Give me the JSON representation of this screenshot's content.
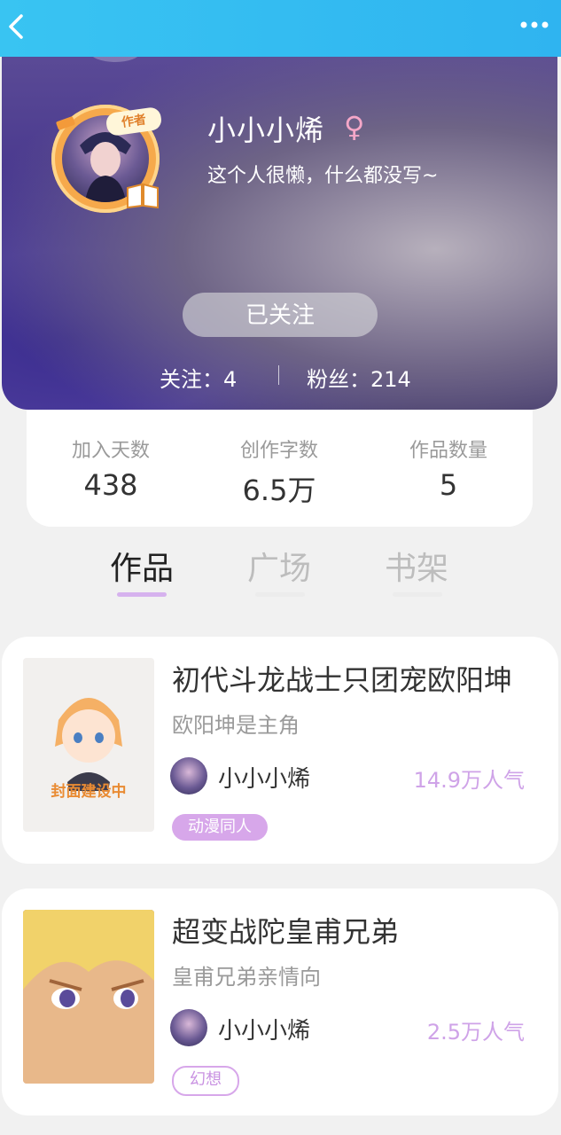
{
  "header": {
    "back_icon": "chevron-left-icon",
    "more_icon": "more-dots-icon"
  },
  "profile": {
    "author_badge": "作者",
    "name": "小小小烯",
    "gender_symbol": "♀",
    "bio": "这个人很懒，什么都没写~",
    "follow_button": "已关注",
    "following_label": "关注：4",
    "fans_label": "粉丝：214"
  },
  "info": [
    {
      "label": "加入天数",
      "value": "438"
    },
    {
      "label": "创作字数",
      "value": "6.5万"
    },
    {
      "label": "作品数量",
      "value": "5"
    }
  ],
  "tabs": [
    {
      "label": "作品",
      "active": true
    },
    {
      "label": "广场",
      "active": false
    },
    {
      "label": "书架",
      "active": false
    }
  ],
  "works": [
    {
      "cover_text": "封面建设中",
      "title": "初代斗龙战士只团宠欧阳坤",
      "desc": "欧阳坤是主角",
      "author": "小小小烯",
      "popularity": "14.9万人气",
      "tag": "动漫同人"
    },
    {
      "title": "超变战陀皇甫兄弟",
      "desc": "皇甫兄弟亲情向",
      "author": "小小小烯",
      "popularity": "2.5万人气",
      "tag": "幻想"
    }
  ],
  "colors": {
    "accent": "#d7a7ea",
    "topbar": "#2fb4f0",
    "tab_underline": "#d6b2ee"
  }
}
